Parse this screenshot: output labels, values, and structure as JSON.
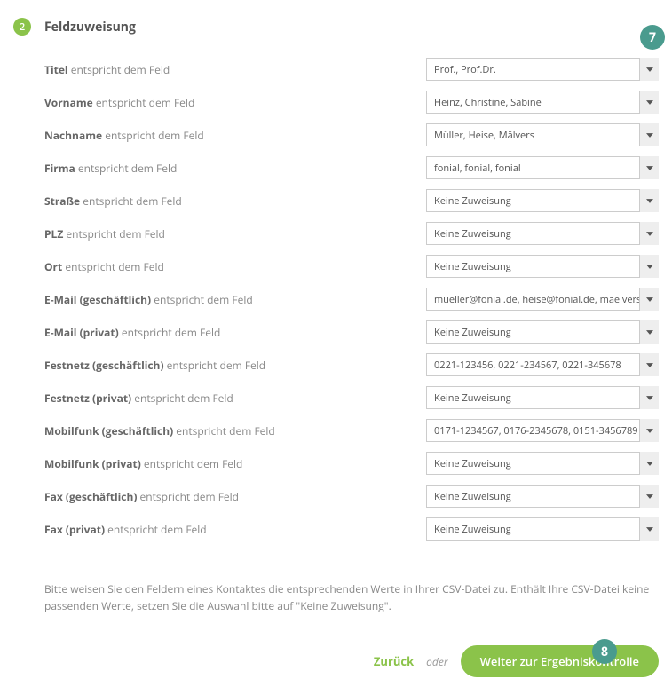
{
  "section": {
    "step_number": "2",
    "title": "Feldzuweisung"
  },
  "label_suffix": "entspricht dem Feld",
  "fields": [
    {
      "label": "Titel",
      "value": "Prof., Prof.Dr."
    },
    {
      "label": "Vorname",
      "value": "Heinz, Christine, Sabine"
    },
    {
      "label": "Nachname",
      "value": "Müller, Heise, Mälvers"
    },
    {
      "label": "Firma",
      "value": "fonial, fonial, fonial"
    },
    {
      "label": "Straße",
      "value": "Keine Zuweisung"
    },
    {
      "label": "PLZ",
      "value": "Keine Zuweisung"
    },
    {
      "label": "Ort",
      "value": "Keine Zuweisung"
    },
    {
      "label": "E-Mail (geschäftlich)",
      "value": "mueller@fonial.de, heise@fonial.de, maelvers@fonial.de"
    },
    {
      "label": "E-Mail (privat)",
      "value": "Keine Zuweisung"
    },
    {
      "label": "Festnetz (geschäftlich)",
      "value": "0221-123456, 0221-234567, 0221-345678"
    },
    {
      "label": "Festnetz (privat)",
      "value": "Keine Zuweisung"
    },
    {
      "label": "Mobilfunk (geschäftlich)",
      "value": "0171-1234567, 0176-2345678, 0151-3456789"
    },
    {
      "label": "Mobilfunk (privat)",
      "value": "Keine Zuweisung"
    },
    {
      "label": "Fax (geschäftlich)",
      "value": "Keine Zuweisung"
    },
    {
      "label": "Fax (privat)",
      "value": "Keine Zuweisung"
    }
  ],
  "help_text": "Bitte weisen Sie den Feldern eines Kontaktes die entsprechenden Werte in Ihrer CSV-Datei zu. Enthält Ihre CSV-Datei keine passenden Werte, setzen Sie die Auswahl bitte auf \"Keine Zuweisung\".",
  "actions": {
    "back": "Zurück",
    "or": "oder",
    "next": "Weiter zur Ergebniskontrolle"
  },
  "annotations": {
    "a7": "7",
    "a8": "8"
  }
}
